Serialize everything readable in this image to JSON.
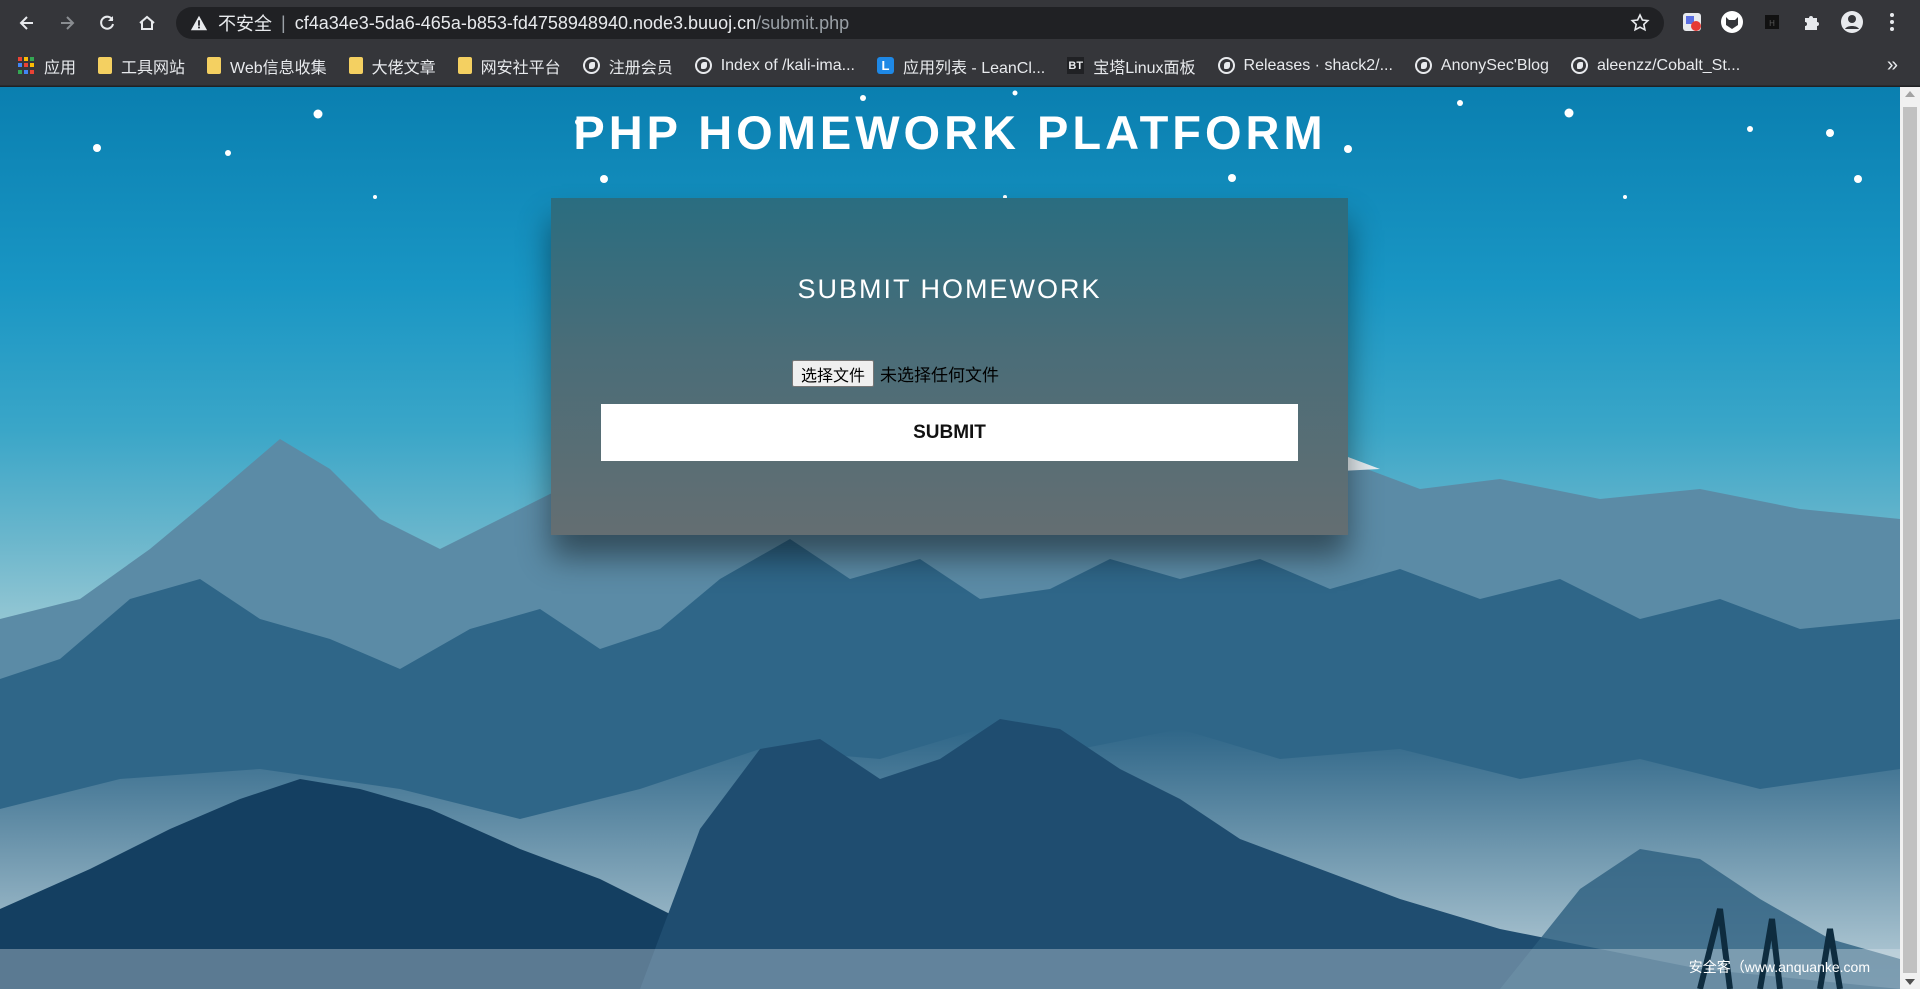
{
  "browser": {
    "insecure_label": "不安全",
    "separator": "|",
    "url_host": "cf4a34e3-5da6-465a-b853-fd4758948940.node3.buuoj.cn",
    "url_path": "/submit.php"
  },
  "bookmarks": {
    "items": [
      {
        "label": "应用",
        "icon": "apps-grid-icon"
      },
      {
        "label": "工具网站",
        "icon": "folder-icon"
      },
      {
        "label": "Web信息收集",
        "icon": "folder-icon"
      },
      {
        "label": "大佬文章",
        "icon": "folder-icon"
      },
      {
        "label": "网安社平台",
        "icon": "folder-icon"
      },
      {
        "label": "注册会员",
        "icon": "globe-icon"
      },
      {
        "label": "Index of /kali-ima...",
        "icon": "globe-icon"
      },
      {
        "label": "应用列表 - LeanCl...",
        "icon": "leancloud-icon",
        "badge": "L"
      },
      {
        "label": "宝塔Linux面板",
        "icon": "bt-icon",
        "badge": "BT"
      },
      {
        "label": "Releases · shack2/...",
        "icon": "globe-icon"
      },
      {
        "label": "AnonySec'Blog",
        "icon": "globe-icon"
      },
      {
        "label": "aleenzz/Cobalt_St...",
        "icon": "globe-icon"
      }
    ],
    "more": "»"
  },
  "page": {
    "site_title": "PHP HOMEWORK PLATFORM",
    "form_title": "SUBMIT HOMEWORK",
    "file_button": "选择文件",
    "file_status": "未选择任何文件",
    "submit_label": "SUBMIT"
  },
  "watermark": "安全客（www.anquanke.com",
  "colors": {
    "chrome_bg": "#35363a",
    "omnibox_bg": "#202124",
    "sky_top": "#0a7fb0",
    "panel_top": "#2a6d80",
    "panel_bottom": "#646e72"
  }
}
